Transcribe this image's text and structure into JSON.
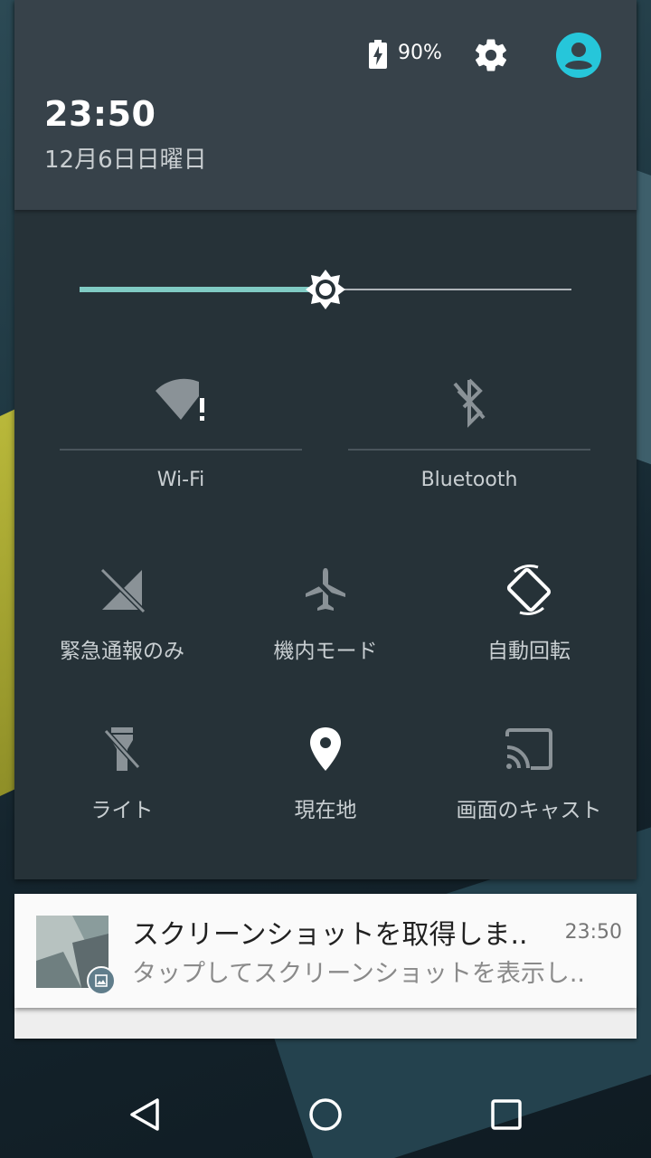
{
  "status": {
    "battery_percent": "90%",
    "time": "23:50",
    "date": "12月6日日曜日"
  },
  "brightness": {
    "level": 0.5
  },
  "tiles_large": [
    {
      "label": "Wi-Fi",
      "icon": "wifi-alert-icon"
    },
    {
      "label": "Bluetooth",
      "icon": "bluetooth-off-icon"
    }
  ],
  "tiles": [
    {
      "label": "緊急通報のみ",
      "icon": "no-signal-icon"
    },
    {
      "label": "機内モード",
      "icon": "airplane-icon"
    },
    {
      "label": "自動回転",
      "icon": "screen-rotation-icon"
    },
    {
      "label": "ライト",
      "icon": "flashlight-off-icon"
    },
    {
      "label": "現在地",
      "icon": "location-icon"
    },
    {
      "label": "画面のキャスト",
      "icon": "cast-icon"
    }
  ],
  "notification": {
    "title": "スクリーンショットを取得しま..",
    "time": "23:50",
    "text": "タップしてスクリーンショットを表示し.."
  },
  "colors": {
    "accent": "#80cbc4",
    "avatar": "#26c6da",
    "shade_bg": "#263238",
    "header_bg": "#37424a"
  }
}
